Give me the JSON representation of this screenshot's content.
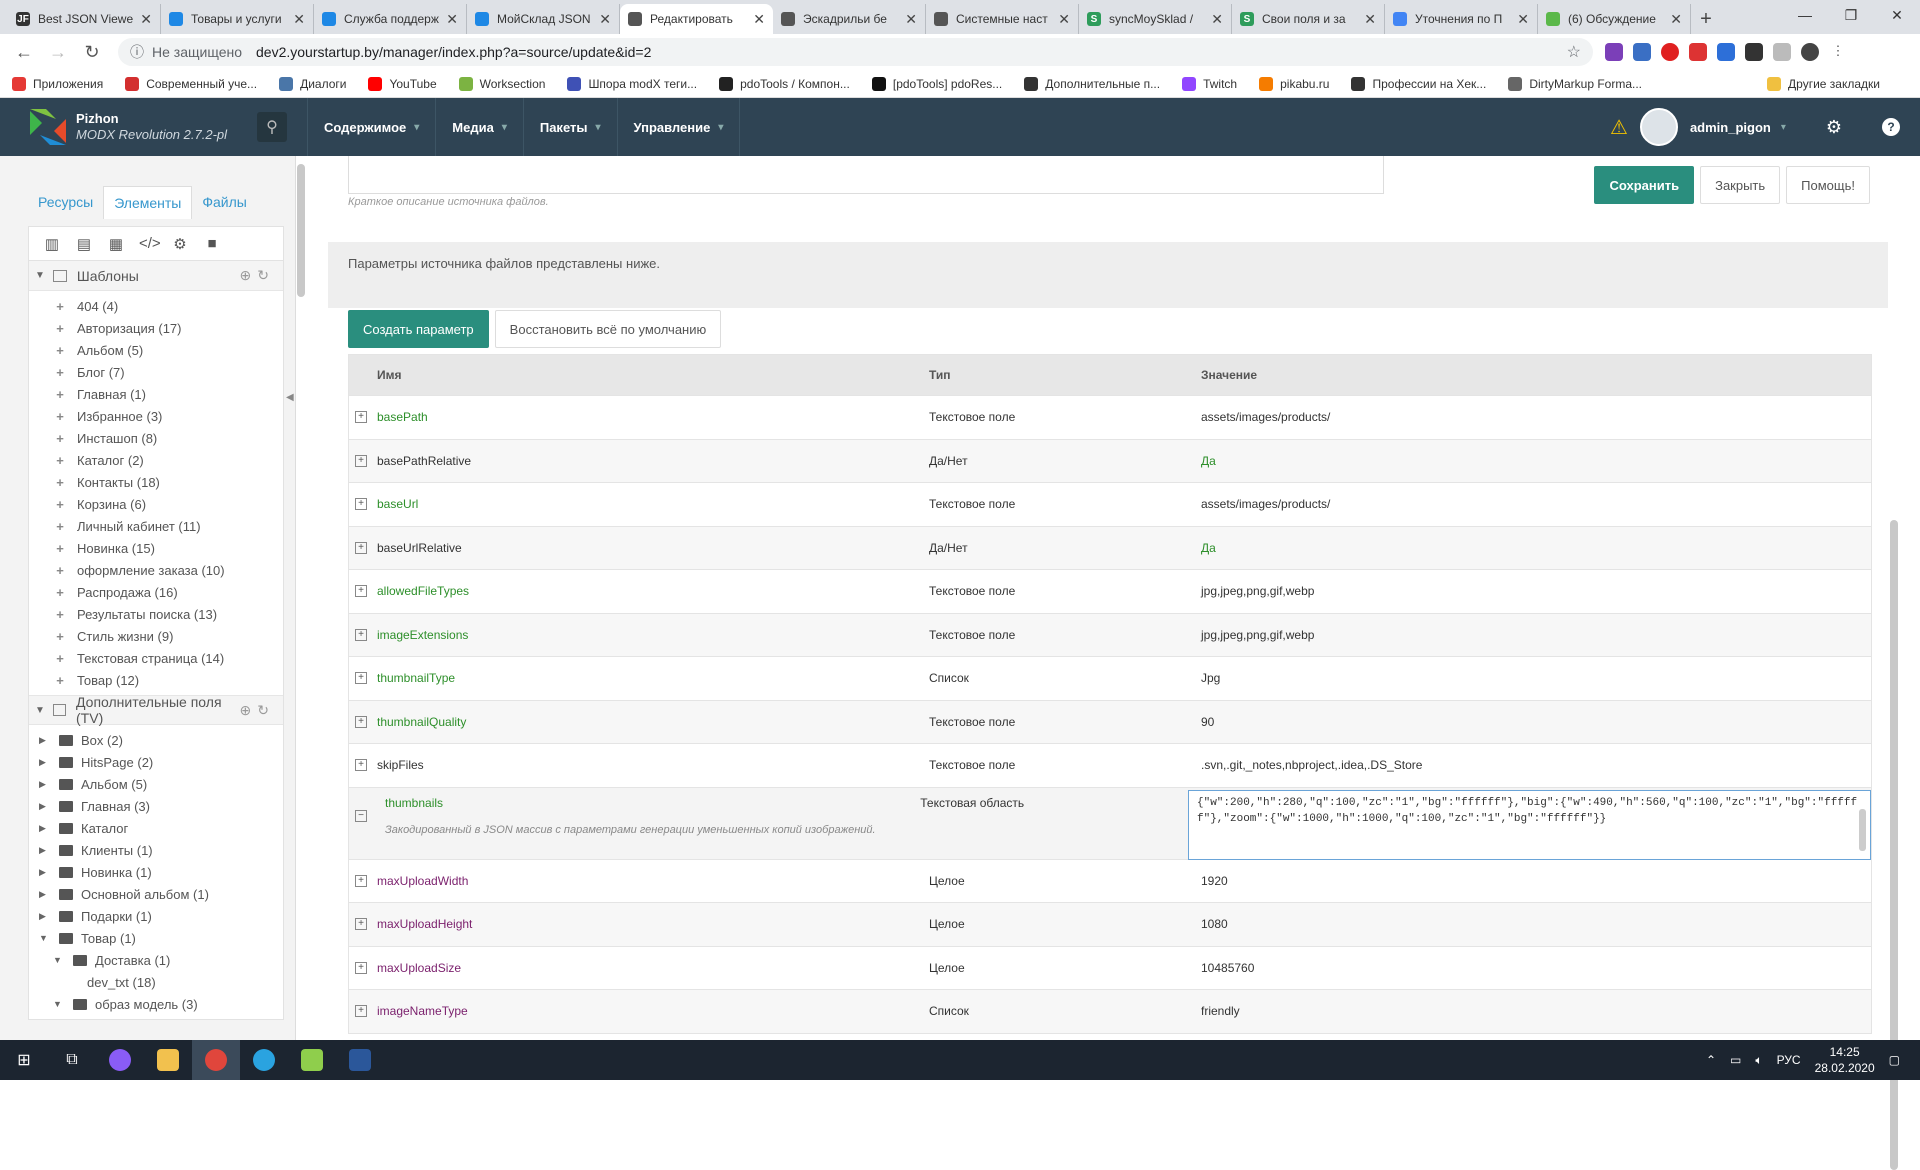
{
  "browser": {
    "tabs": [
      {
        "label": "Best JSON Viewe",
        "fav": "JF",
        "color": "#333333"
      },
      {
        "label": "Товары и услуги",
        "fav": "",
        "color": "#1e88e5"
      },
      {
        "label": "Служба поддерж",
        "fav": "",
        "color": "#1e88e5"
      },
      {
        "label": "МойСклад JSON",
        "fav": "",
        "color": "#1e88e5"
      },
      {
        "label": "Редактировать",
        "fav": "",
        "color": "#555555"
      },
      {
        "label": "Эскадрильи бе",
        "fav": "",
        "color": "#555555"
      },
      {
        "label": "Системные наст",
        "fav": "",
        "color": "#555555"
      },
      {
        "label": "syncMoySklad /",
        "fav": "S",
        "color": "#2e9c5b"
      },
      {
        "label": "Свои поля и за",
        "fav": "S",
        "color": "#2e9c5b"
      },
      {
        "label": "Уточнения по П",
        "fav": "",
        "color": "#4285f4"
      },
      {
        "label": "(6) Обсуждение",
        "fav": "",
        "color": "#5bb84a"
      }
    ],
    "active_tab": 4,
    "address": {
      "security": "Не защищено",
      "url": "dev2.yourstartup.by/manager/index.php?a=source/update&id=2"
    },
    "bookmarks": [
      {
        "label": "Приложения",
        "color": "#e53935"
      },
      {
        "label": "Современный уче...",
        "color": "#d32f2f"
      },
      {
        "label": "Диалоги",
        "color": "#4a76a8"
      },
      {
        "label": "YouTube",
        "color": "#ff0000"
      },
      {
        "label": "Worksection",
        "color": "#7cb342"
      },
      {
        "label": "Шпора modX теги...",
        "color": "#3f51b5"
      },
      {
        "label": "pdoTools / Компон...",
        "color": "#222222"
      },
      {
        "label": "[pdoTools] pdoRes...",
        "color": "#111111"
      },
      {
        "label": "Дополнительные п...",
        "color": "#333333"
      },
      {
        "label": "Twitch",
        "color": "#9146ff"
      },
      {
        "label": "pikabu.ru",
        "color": "#f57c00"
      },
      {
        "label": "Профессии на Хек...",
        "color": "#333333"
      },
      {
        "label": "DirtyMarkup Forma...",
        "color": "#666666"
      }
    ],
    "other_bookmarks": "Другие закладки"
  },
  "header": {
    "site_name": "Pizhon",
    "version": "MODX Revolution 2.7.2-pl",
    "menu": [
      "Содержимое",
      "Медиа",
      "Пакеты",
      "Управление"
    ],
    "username": "admin_pigon"
  },
  "sidebar": {
    "tabs": [
      "Ресурсы",
      "Элементы",
      "Файлы"
    ],
    "active_tab": 1,
    "templates_title": "Шаблоны",
    "templates": [
      "404 (4)",
      "Авторизация (17)",
      "Альбом (5)",
      "Блог (7)",
      "Главная (1)",
      "Избранное (3)",
      "Инсташоп (8)",
      "Каталог (2)",
      "Контакты (18)",
      "Корзина (6)",
      "Личный кабинет (11)",
      "Новинка (15)",
      "оформление заказа (10)",
      "Распродажа (16)",
      "Результаты поиска (13)",
      "Стиль жизни (9)",
      "Текстовая страница (14)",
      "Товар (12)"
    ],
    "tv_title": "Дополнительные поля (TV)",
    "tvs": [
      {
        "label": "Box (2)",
        "level": 0,
        "open": false
      },
      {
        "label": "HitsPage (2)",
        "level": 0,
        "open": false
      },
      {
        "label": "Альбом (5)",
        "level": 0,
        "open": false
      },
      {
        "label": "Главная (3)",
        "level": 0,
        "open": false
      },
      {
        "label": "Каталог",
        "level": 0,
        "open": false
      },
      {
        "label": "Клиенты (1)",
        "level": 0,
        "open": false
      },
      {
        "label": "Новинка (1)",
        "level": 0,
        "open": false
      },
      {
        "label": "Основной альбом (1)",
        "level": 0,
        "open": false
      },
      {
        "label": "Подарки (1)",
        "level": 0,
        "open": false
      },
      {
        "label": "Товар (1)",
        "level": 0,
        "open": true
      },
      {
        "label": "Доставка (1)",
        "level": 1,
        "open": true
      },
      {
        "label": "dev_txt (18)",
        "level": 2,
        "open": false
      },
      {
        "label": "образ модель (3)",
        "level": 1,
        "open": true
      }
    ]
  },
  "main": {
    "description_hint": "Краткое описание источника файлов.",
    "params_intro": "Параметры источника файлов представлены ниже.",
    "buttons": {
      "save": "Сохранить",
      "close": "Закрыть",
      "help": "Помощь!",
      "create": "Создать параметр",
      "reset": "Восстановить всё по умолчанию"
    },
    "grid": {
      "headers": [
        "Имя",
        "Тип",
        "Значение"
      ],
      "rows": [
        {
          "name": "basePath",
          "type": "Текстовое поле",
          "value": "assets/images/products/",
          "nc": "green",
          "vc": "dark"
        },
        {
          "name": "basePathRelative",
          "type": "Да/Нет",
          "value": "Да",
          "nc": "dark",
          "vc": "green"
        },
        {
          "name": "baseUrl",
          "type": "Текстовое поле",
          "value": "assets/images/products/",
          "nc": "green",
          "vc": "dark"
        },
        {
          "name": "baseUrlRelative",
          "type": "Да/Нет",
          "value": "Да",
          "nc": "dark",
          "vc": "green"
        },
        {
          "name": "allowedFileTypes",
          "type": "Текстовое поле",
          "value": "jpg,jpeg,png,gif,webp",
          "nc": "green",
          "vc": "dark"
        },
        {
          "name": "imageExtensions",
          "type": "Текстовое поле",
          "value": "jpg,jpeg,png,gif,webp",
          "nc": "green",
          "vc": "dark"
        },
        {
          "name": "thumbnailType",
          "type": "Список",
          "value": "Jpg",
          "nc": "green",
          "vc": "dark"
        },
        {
          "name": "thumbnailQuality",
          "type": "Текстовое поле",
          "value": "90",
          "nc": "green",
          "vc": "dark"
        },
        {
          "name": "skipFiles",
          "type": "Текстовое поле",
          "value": ".svn,.git,_notes,nbproject,.idea,.DS_Store",
          "nc": "dark",
          "vc": "dark"
        }
      ],
      "expanded_row": {
        "name": "thumbnails",
        "type": "Текстовая область",
        "description": "Закодированный в JSON массив с параметрами генерации уменьшенных копий изображений.",
        "value": "{\"w\":200,\"h\":280,\"q\":100,\"zc\":\"1\",\"bg\":\"ffffff\"},\"big\":{\"w\":490,\"h\":560,\"q\":100,\"zc\":\"1\",\"bg\":\"ffffff\"},\"zoom\":{\"w\":1000,\"h\":1000,\"q\":100,\"zc\":\"1\",\"bg\":\"ffffff\"}}"
      },
      "rows_after": [
        {
          "name": "maxUploadWidth",
          "type": "Целое",
          "value": "1920",
          "nc": "purple",
          "vc": "dark"
        },
        {
          "name": "maxUploadHeight",
          "type": "Целое",
          "value": "1080",
          "nc": "purple",
          "vc": "dark"
        },
        {
          "name": "maxUploadSize",
          "type": "Целое",
          "value": "10485760",
          "nc": "purple",
          "vc": "dark"
        },
        {
          "name": "imageNameType",
          "type": "Список",
          "value": "friendly",
          "nc": "purple",
          "vc": "dark"
        }
      ]
    }
  },
  "taskbar": {
    "lang": "РУС",
    "time": "14:25",
    "date": "28.02.2020"
  }
}
